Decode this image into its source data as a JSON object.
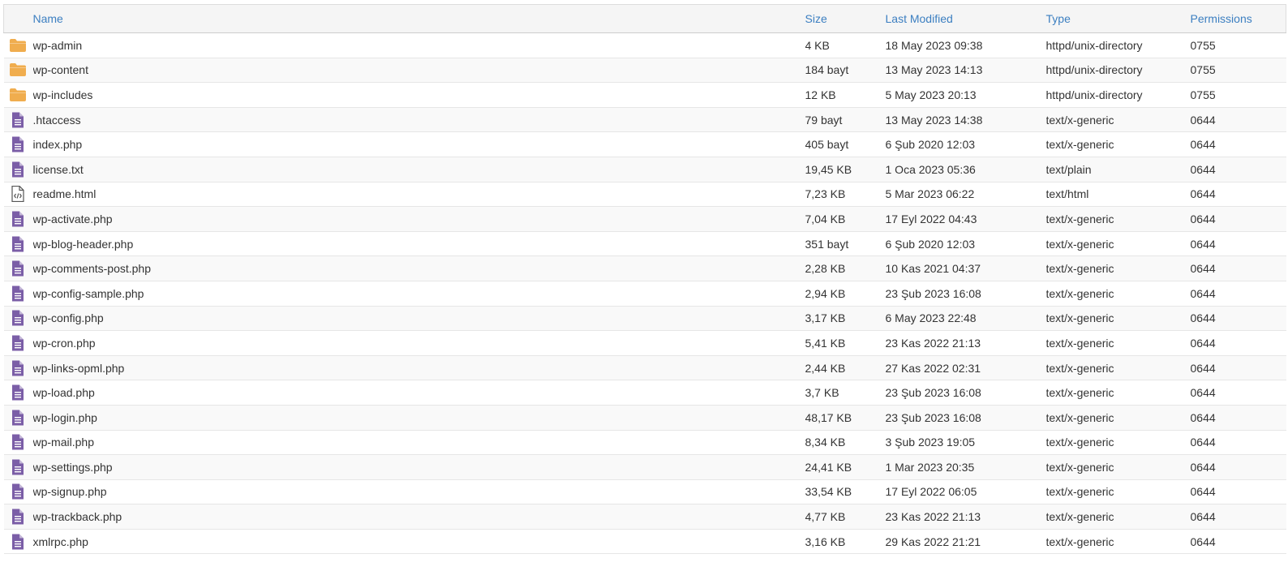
{
  "colors": {
    "header_text": "#3c7fc1",
    "folder_icon": "#f0ad4e",
    "file_icon": "#7b5ea7"
  },
  "columns": {
    "name": "Name",
    "size": "Size",
    "last_modified": "Last Modified",
    "type": "Type",
    "permissions": "Permissions"
  },
  "rows": [
    {
      "icon": "folder-icon",
      "name": "wp-admin",
      "size": "4 KB",
      "modified": "18 May 2023 09:38",
      "type": "httpd/unix-directory",
      "perms": "0755"
    },
    {
      "icon": "folder-icon",
      "name": "wp-content",
      "size": "184 bayt",
      "modified": "13 May 2023 14:13",
      "type": "httpd/unix-directory",
      "perms": "0755"
    },
    {
      "icon": "folder-icon",
      "name": "wp-includes",
      "size": "12 KB",
      "modified": "5 May 2023 20:13",
      "type": "httpd/unix-directory",
      "perms": "0755"
    },
    {
      "icon": "file-text-icon",
      "name": ".htaccess",
      "size": "79 bayt",
      "modified": "13 May 2023 14:38",
      "type": "text/x-generic",
      "perms": "0644"
    },
    {
      "icon": "file-text-icon",
      "name": "index.php",
      "size": "405 bayt",
      "modified": "6 Şub 2020 12:03",
      "type": "text/x-generic",
      "perms": "0644"
    },
    {
      "icon": "file-text-icon",
      "name": "license.txt",
      "size": "19,45 KB",
      "modified": "1 Oca 2023 05:36",
      "type": "text/plain",
      "perms": "0644"
    },
    {
      "icon": "file-code-icon",
      "name": "readme.html",
      "size": "7,23 KB",
      "modified": "5 Mar 2023 06:22",
      "type": "text/html",
      "perms": "0644"
    },
    {
      "icon": "file-text-icon",
      "name": "wp-activate.php",
      "size": "7,04 KB",
      "modified": "17 Eyl 2022 04:43",
      "type": "text/x-generic",
      "perms": "0644"
    },
    {
      "icon": "file-text-icon",
      "name": "wp-blog-header.php",
      "size": "351 bayt",
      "modified": "6 Şub 2020 12:03",
      "type": "text/x-generic",
      "perms": "0644"
    },
    {
      "icon": "file-text-icon",
      "name": "wp-comments-post.php",
      "size": "2,28 KB",
      "modified": "10 Kas 2021 04:37",
      "type": "text/x-generic",
      "perms": "0644"
    },
    {
      "icon": "file-text-icon",
      "name": "wp-config-sample.php",
      "size": "2,94 KB",
      "modified": "23 Şub 2023 16:08",
      "type": "text/x-generic",
      "perms": "0644"
    },
    {
      "icon": "file-text-icon",
      "name": "wp-config.php",
      "size": "3,17 KB",
      "modified": "6 May 2023 22:48",
      "type": "text/x-generic",
      "perms": "0644"
    },
    {
      "icon": "file-text-icon",
      "name": "wp-cron.php",
      "size": "5,41 KB",
      "modified": "23 Kas 2022 21:13",
      "type": "text/x-generic",
      "perms": "0644"
    },
    {
      "icon": "file-text-icon",
      "name": "wp-links-opml.php",
      "size": "2,44 KB",
      "modified": "27 Kas 2022 02:31",
      "type": "text/x-generic",
      "perms": "0644"
    },
    {
      "icon": "file-text-icon",
      "name": "wp-load.php",
      "size": "3,7 KB",
      "modified": "23 Şub 2023 16:08",
      "type": "text/x-generic",
      "perms": "0644"
    },
    {
      "icon": "file-text-icon",
      "name": "wp-login.php",
      "size": "48,17 KB",
      "modified": "23 Şub 2023 16:08",
      "type": "text/x-generic",
      "perms": "0644"
    },
    {
      "icon": "file-text-icon",
      "name": "wp-mail.php",
      "size": "8,34 KB",
      "modified": "3 Şub 2023 19:05",
      "type": "text/x-generic",
      "perms": "0644"
    },
    {
      "icon": "file-text-icon",
      "name": "wp-settings.php",
      "size": "24,41 KB",
      "modified": "1 Mar 2023 20:35",
      "type": "text/x-generic",
      "perms": "0644"
    },
    {
      "icon": "file-text-icon",
      "name": "wp-signup.php",
      "size": "33,54 KB",
      "modified": "17 Eyl 2022 06:05",
      "type": "text/x-generic",
      "perms": "0644"
    },
    {
      "icon": "file-text-icon",
      "name": "wp-trackback.php",
      "size": "4,77 KB",
      "modified": "23 Kas 2022 21:13",
      "type": "text/x-generic",
      "perms": "0644"
    },
    {
      "icon": "file-text-icon",
      "name": "xmlrpc.php",
      "size": "3,16 KB",
      "modified": "29 Kas 2022 21:21",
      "type": "text/x-generic",
      "perms": "0644"
    }
  ]
}
